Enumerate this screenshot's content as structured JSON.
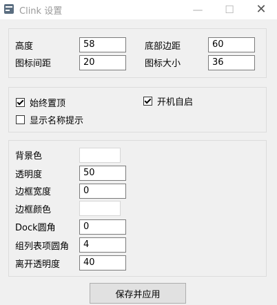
{
  "window": {
    "title": "Clink 设置",
    "icons": {
      "app": "clink-app-icon",
      "minimize": "minimize-icon",
      "maximize": "maximize-icon",
      "close": "close-icon"
    },
    "minimize_glyph": "—",
    "maximize_glyph": "☐",
    "close_glyph": "✕"
  },
  "size_group": {
    "height_label": "高度",
    "height_value": "58",
    "bottom_margin_label": "底部边距",
    "bottom_margin_value": "60",
    "icon_spacing_label": "图标间距",
    "icon_spacing_value": "20",
    "icon_size_label": "图标大小",
    "icon_size_value": "36"
  },
  "options_group": {
    "always_on_top": {
      "label": "始终置顶",
      "checked": true
    },
    "autostart": {
      "label": "开机自启",
      "checked": true
    },
    "show_name_tip": {
      "label": "显示名称提示",
      "checked": false
    }
  },
  "appearance_group": {
    "background_color_label": "背景色",
    "background_color_value": "",
    "opacity_label": "透明度",
    "opacity_value": "50",
    "border_width_label": "边框宽度",
    "border_width_value": "0",
    "border_color_label": "边框颜色",
    "border_color_value": "",
    "dock_radius_label": "Dock圆角",
    "dock_radius_value": "0",
    "group_list_radius_label": "组列表项圆角",
    "group_list_radius_value": "4",
    "leave_opacity_label": "离开透明度",
    "leave_opacity_value": "40"
  },
  "footer": {
    "save_apply_label": "保存并应用"
  },
  "colors": {
    "window_bg": "#f0f0f0",
    "titlebar_bg": "#ffffff",
    "input_border": "#7a7a7a",
    "group_border": "#dcdcdc"
  }
}
